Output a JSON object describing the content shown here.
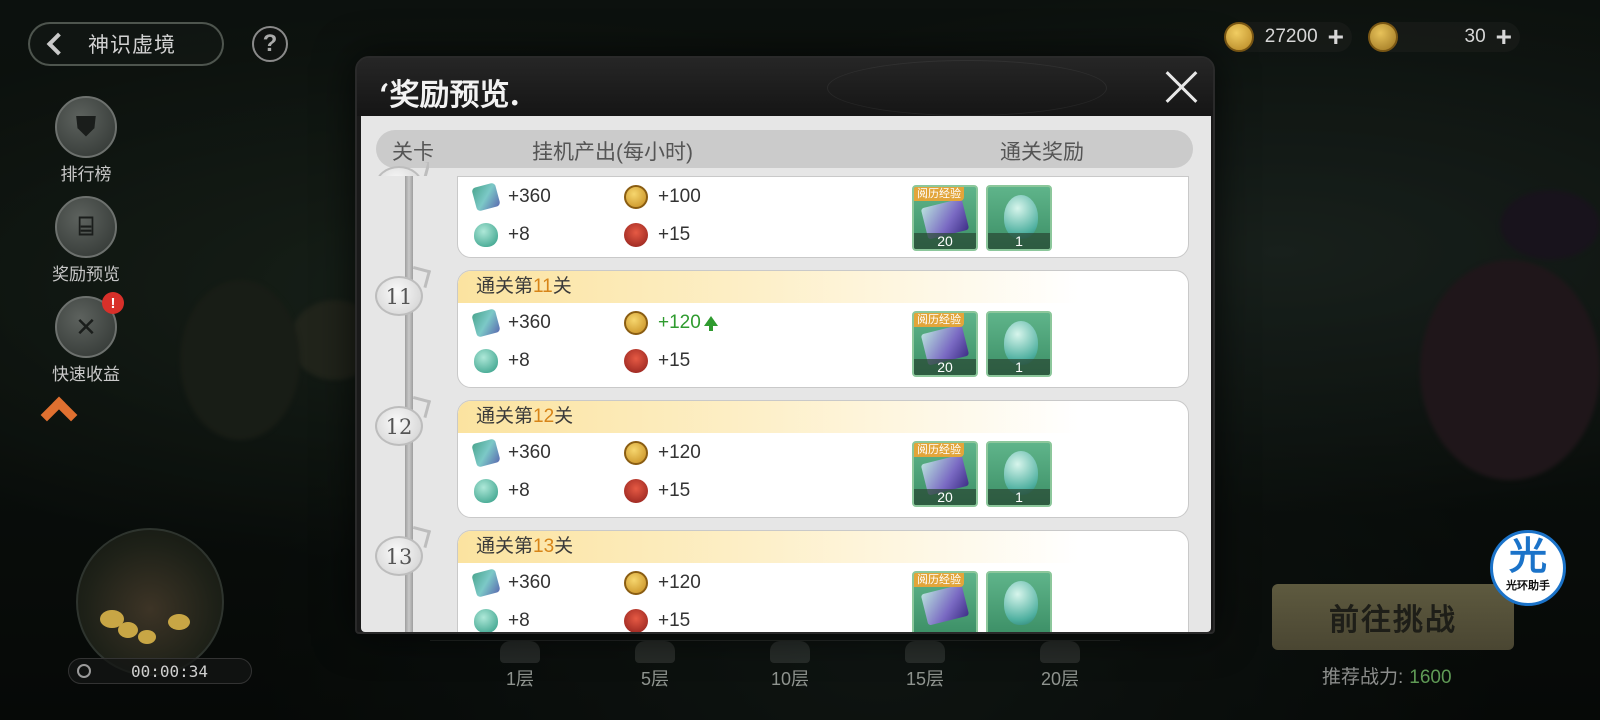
{
  "top_nav": {
    "back_label": "神识虚境",
    "help_label": "?"
  },
  "side_menu": [
    {
      "label": "排行榜",
      "icon": "ranking-icon"
    },
    {
      "label": "奖励预览",
      "icon": "reward-preview-icon"
    },
    {
      "label": "快速收益",
      "icon": "quick-earnings-icon",
      "badge": "!"
    }
  ],
  "currencies": [
    {
      "value": "27200",
      "icon": "coin-icon"
    },
    {
      "value": "30",
      "icon": "token-icon"
    }
  ],
  "timer": "00:00:34",
  "floors": [
    "1层",
    "5层",
    "10层",
    "15层",
    "20层"
  ],
  "challenge_button": "前往挑战",
  "power": {
    "label": "推荐战力:",
    "value": "1600"
  },
  "halo_assistant": {
    "icon": "光",
    "label": "光环助手"
  },
  "modal": {
    "title": "‘奖励预览.",
    "columns": {
      "stage": "关卡",
      "idle": "挂机产出(每小时)",
      "clear": "通关奖励"
    },
    "rows": [
      {
        "stage": "",
        "title_prefix": "",
        "title_num": "",
        "title_suffix": "",
        "stats": {
          "book": "+360",
          "coin": "+100",
          "egg": "+8",
          "chest": "+15"
        },
        "coin_up": false,
        "rewards": [
          {
            "tag": "阅历经验",
            "count": "20",
            "type": "book"
          },
          {
            "tag": "",
            "count": "1",
            "type": "egg"
          }
        ]
      },
      {
        "stage": "11",
        "title_prefix": "通关第",
        "title_num": "11",
        "title_suffix": "关",
        "stats": {
          "book": "+360",
          "coin": "+120",
          "egg": "+8",
          "chest": "+15"
        },
        "coin_up": true,
        "rewards": [
          {
            "tag": "阅历经验",
            "count": "20",
            "type": "book"
          },
          {
            "tag": "",
            "count": "1",
            "type": "egg"
          }
        ]
      },
      {
        "stage": "12",
        "title_prefix": "通关第",
        "title_num": "12",
        "title_suffix": "关",
        "stats": {
          "book": "+360",
          "coin": "+120",
          "egg": "+8",
          "chest": "+15"
        },
        "coin_up": false,
        "rewards": [
          {
            "tag": "阅历经验",
            "count": "20",
            "type": "book"
          },
          {
            "tag": "",
            "count": "1",
            "type": "egg"
          }
        ]
      },
      {
        "stage": "13",
        "title_prefix": "通关第",
        "title_num": "13",
        "title_suffix": "关",
        "stats": {
          "book": "+360",
          "coin": "+120",
          "egg": "+8",
          "chest": "+15"
        },
        "coin_up": false,
        "rewards": [
          {
            "tag": "阅历经验",
            "count": "",
            "type": "book"
          },
          {
            "tag": "",
            "count": "",
            "type": "egg"
          }
        ]
      }
    ]
  }
}
